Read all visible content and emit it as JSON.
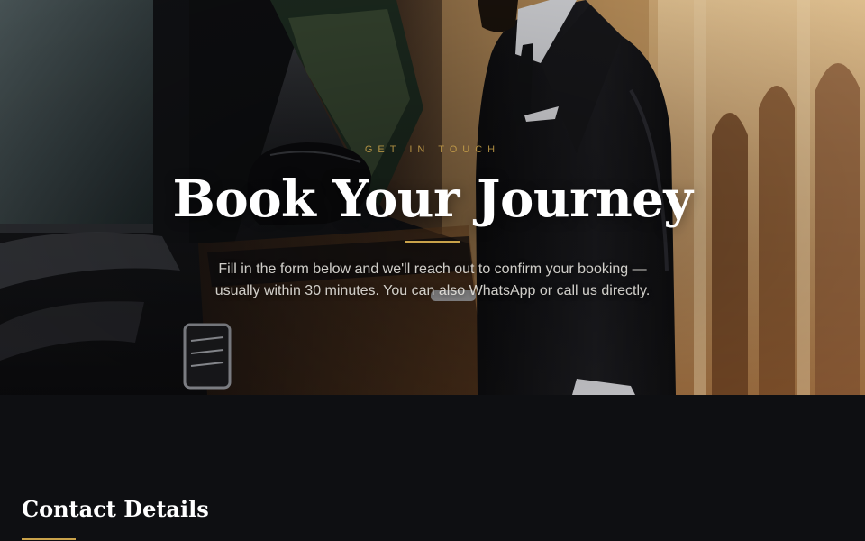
{
  "hero": {
    "eyebrow": "GET IN TOUCH",
    "title": "Book Your Journey",
    "description": "Fill in the form below and we'll reach out to confirm your booking — usually within 30 minutes. You can also WhatsApp or call us directly.",
    "image_subject": "chauffeur in black suit opening door of black luxury car"
  },
  "contact": {
    "heading": "Contact Details"
  },
  "colors": {
    "accent_gold": "#c9a24a",
    "background_dark": "#0e0f12",
    "text_light": "#ffffff"
  }
}
